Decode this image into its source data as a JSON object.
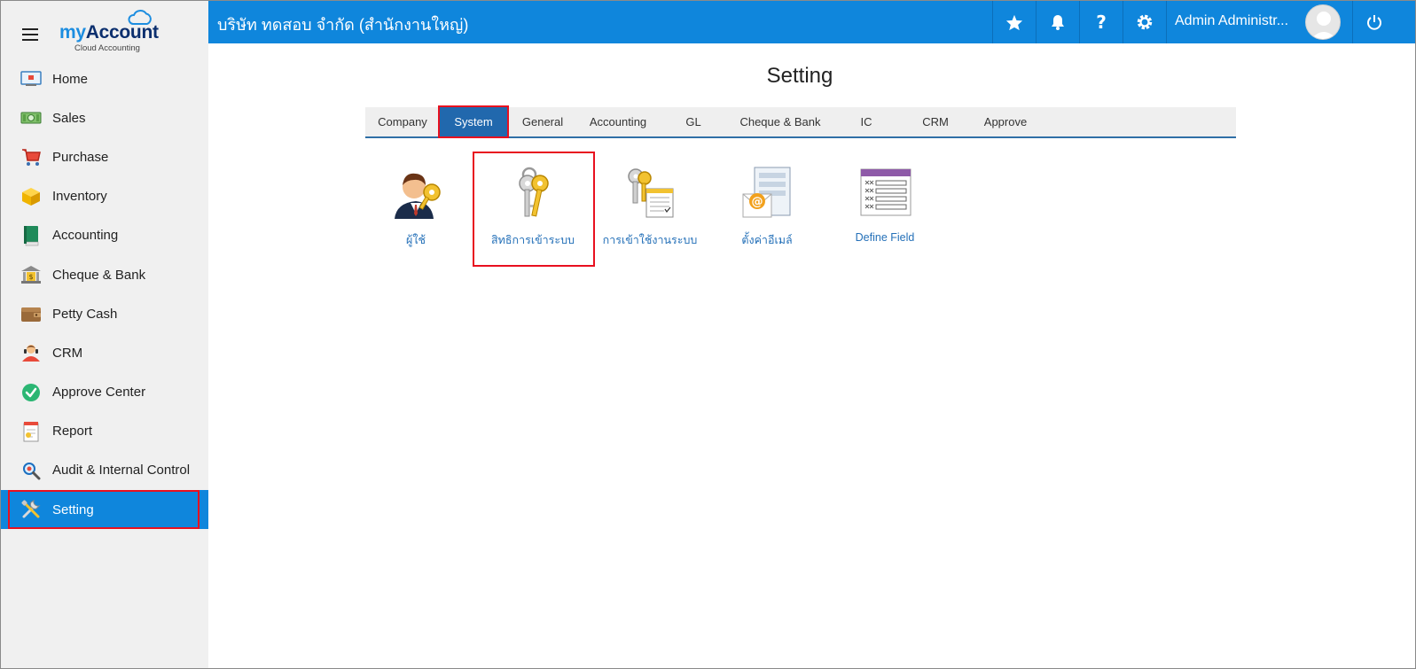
{
  "brand": {
    "logo_my": "my",
    "logo_account": "Account",
    "logo_tagline": "Cloud Accounting"
  },
  "topbar": {
    "company_name": "บริษัท ทดสอบ จำกัด (สำนักงานใหญ่)",
    "user_name": "Admin Administr...",
    "icons": [
      "star-icon",
      "bell-icon",
      "help-icon",
      "gear-icon",
      "power-icon"
    ]
  },
  "sidebar": {
    "items": [
      {
        "label": "Home",
        "icon": "home-icon"
      },
      {
        "label": "Sales",
        "icon": "sales-icon"
      },
      {
        "label": "Purchase",
        "icon": "cart-icon"
      },
      {
        "label": "Inventory",
        "icon": "box-icon"
      },
      {
        "label": "Accounting",
        "icon": "ledger-icon"
      },
      {
        "label": "Cheque & Bank",
        "icon": "bank-icon"
      },
      {
        "label": "Petty Cash",
        "icon": "wallet-icon"
      },
      {
        "label": "CRM",
        "icon": "crm-icon"
      },
      {
        "label": "Approve Center",
        "icon": "check-circle-icon"
      },
      {
        "label": "Report",
        "icon": "report-icon"
      },
      {
        "label": "Audit & Internal Control",
        "icon": "magnifier-icon"
      },
      {
        "label": "Setting",
        "icon": "tools-icon",
        "active": true
      }
    ]
  },
  "main": {
    "title": "Setting",
    "tabs": [
      {
        "label": "Company"
      },
      {
        "label": "System",
        "active": true
      },
      {
        "label": "General"
      },
      {
        "label": "Accounting"
      },
      {
        "label": "GL"
      },
      {
        "label": "Cheque & Bank"
      },
      {
        "label": "IC"
      },
      {
        "label": "CRM"
      },
      {
        "label": "Approve"
      }
    ],
    "tiles": [
      {
        "label": "ผู้ใช้",
        "icon": "user-key-icon"
      },
      {
        "label": "สิทธิการเข้าระบบ",
        "icon": "keys-icon",
        "selected": true
      },
      {
        "label": "การเข้าใช้งานระบบ",
        "icon": "keys-log-icon"
      },
      {
        "label": "ตั้งค่าอีเมล์",
        "icon": "email-settings-icon"
      },
      {
        "label": "Define Field",
        "icon": "define-field-icon"
      }
    ]
  },
  "colors": {
    "primary": "#0f86dc",
    "tab_active": "#2168ad",
    "highlight": "#e8101f",
    "sidebar_bg": "#f0f0f0",
    "link": "#2470b8"
  }
}
